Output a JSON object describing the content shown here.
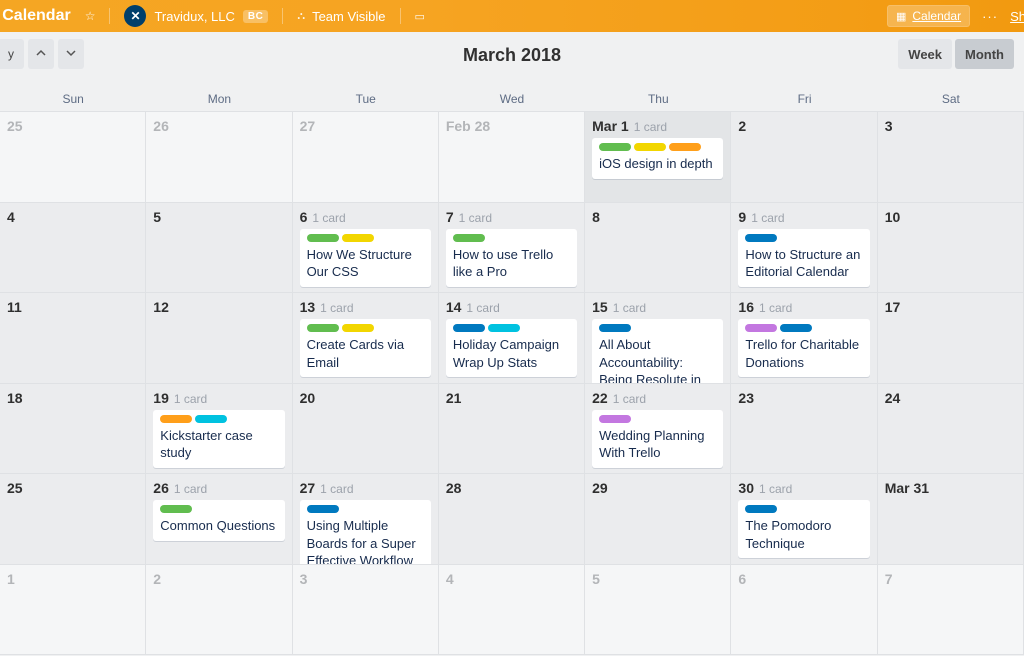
{
  "topbar": {
    "board_title": "ial Calendar",
    "star": "☆",
    "team_avatar": "✕",
    "team_name": "Travidux, LLC",
    "team_badge": "BC",
    "visibility_icon": "👥",
    "visibility": "Team Visible",
    "briefcase": "💼",
    "calendar_icon": "📅",
    "calendar_label": "Calendar",
    "dots": "···",
    "show": "Sh"
  },
  "nav": {
    "today": "y",
    "month_label": "March 2018",
    "week": "Week",
    "month": "Month"
  },
  "dow": [
    "Sun",
    "Mon",
    "Tue",
    "Wed",
    "Thu",
    "Fri",
    "Sat"
  ],
  "cells": [
    {
      "date": "25",
      "out": true
    },
    {
      "date": "26",
      "out": true
    },
    {
      "date": "27",
      "out": true
    },
    {
      "date": "Feb 28",
      "out": true
    },
    {
      "date": "Mar 1",
      "count": "1 card",
      "first": true,
      "card": {
        "labels": [
          "g",
          "y",
          "o"
        ],
        "title": "iOS design in depth"
      }
    },
    {
      "date": "2"
    },
    {
      "date": "3"
    },
    {
      "date": "4"
    },
    {
      "date": "5"
    },
    {
      "date": "6",
      "count": "1 card",
      "card": {
        "labels": [
          "g",
          "y"
        ],
        "title": "How We Structure Our CSS"
      }
    },
    {
      "date": "7",
      "count": "1 card",
      "card": {
        "labels": [
          "g"
        ],
        "title": "How to use Trello like a Pro"
      }
    },
    {
      "date": "8"
    },
    {
      "date": "9",
      "count": "1 card",
      "card": {
        "labels": [
          "b"
        ],
        "title": "How to Structure an Editorial Calendar"
      }
    },
    {
      "date": "10"
    },
    {
      "date": "11"
    },
    {
      "date": "12"
    },
    {
      "date": "13",
      "count": "1 card",
      "card": {
        "labels": [
          "g",
          "y"
        ],
        "title": "Create Cards via Email"
      }
    },
    {
      "date": "14",
      "count": "1 card",
      "card": {
        "labels": [
          "b",
          "c"
        ],
        "title": "Holiday Campaign Wrap Up Stats"
      }
    },
    {
      "date": "15",
      "count": "1 card",
      "card": {
        "labels": [
          "b"
        ],
        "title": "All About Accountability: Being Resolute in Resolutions"
      }
    },
    {
      "date": "16",
      "count": "1 card",
      "card": {
        "labels": [
          "p",
          "b"
        ],
        "title": "Trello for Charitable Donations"
      }
    },
    {
      "date": "17"
    },
    {
      "date": "18"
    },
    {
      "date": "19",
      "count": "1 card",
      "card": {
        "labels": [
          "o",
          "c"
        ],
        "title": "Kickstarter case study"
      }
    },
    {
      "date": "20"
    },
    {
      "date": "21"
    },
    {
      "date": "22",
      "count": "1 card",
      "card": {
        "labels": [
          "p"
        ],
        "title": "Wedding Planning With Trello"
      }
    },
    {
      "date": "23"
    },
    {
      "date": "24"
    },
    {
      "date": "25"
    },
    {
      "date": "26",
      "count": "1 card",
      "card": {
        "labels": [
          "g"
        ],
        "title": "Common Questions"
      }
    },
    {
      "date": "27",
      "count": "1 card",
      "card": {
        "labels": [
          "b"
        ],
        "title": "Using Multiple Boards for a Super Effective Workflow"
      }
    },
    {
      "date": "28"
    },
    {
      "date": "29"
    },
    {
      "date": "30",
      "count": "1 card",
      "card": {
        "labels": [
          "b"
        ],
        "title": "The Pomodoro Technique"
      }
    },
    {
      "date": "Mar 31",
      "last": true
    },
    {
      "date": "1",
      "out": true
    },
    {
      "date": "2",
      "out": true
    },
    {
      "date": "3",
      "out": true
    },
    {
      "date": "4",
      "out": true
    },
    {
      "date": "5",
      "out": true
    },
    {
      "date": "6",
      "out": true
    },
    {
      "date": "7",
      "out": true
    }
  ]
}
